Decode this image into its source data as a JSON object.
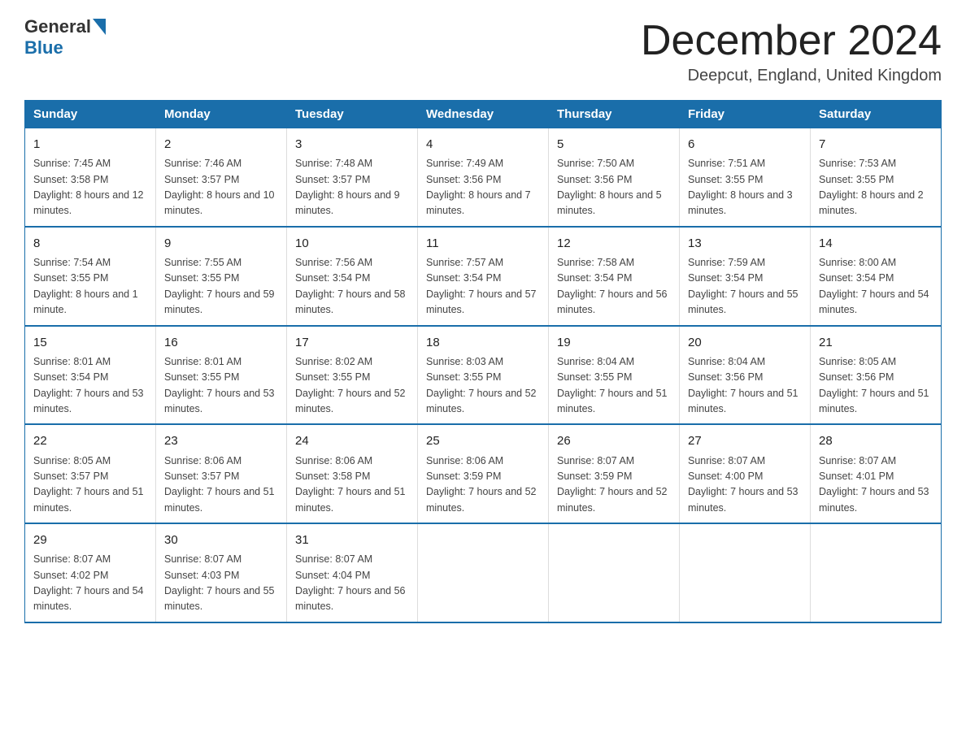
{
  "header": {
    "logo": {
      "general": "General",
      "blue": "Blue"
    },
    "title": "December 2024",
    "location": "Deepcut, England, United Kingdom"
  },
  "columns": [
    "Sunday",
    "Monday",
    "Tuesday",
    "Wednesday",
    "Thursday",
    "Friday",
    "Saturday"
  ],
  "weeks": [
    [
      {
        "day": "1",
        "sunrise": "7:45 AM",
        "sunset": "3:58 PM",
        "daylight": "8 hours and 12 minutes."
      },
      {
        "day": "2",
        "sunrise": "7:46 AM",
        "sunset": "3:57 PM",
        "daylight": "8 hours and 10 minutes."
      },
      {
        "day": "3",
        "sunrise": "7:48 AM",
        "sunset": "3:57 PM",
        "daylight": "8 hours and 9 minutes."
      },
      {
        "day": "4",
        "sunrise": "7:49 AM",
        "sunset": "3:56 PM",
        "daylight": "8 hours and 7 minutes."
      },
      {
        "day": "5",
        "sunrise": "7:50 AM",
        "sunset": "3:56 PM",
        "daylight": "8 hours and 5 minutes."
      },
      {
        "day": "6",
        "sunrise": "7:51 AM",
        "sunset": "3:55 PM",
        "daylight": "8 hours and 3 minutes."
      },
      {
        "day": "7",
        "sunrise": "7:53 AM",
        "sunset": "3:55 PM",
        "daylight": "8 hours and 2 minutes."
      }
    ],
    [
      {
        "day": "8",
        "sunrise": "7:54 AM",
        "sunset": "3:55 PM",
        "daylight": "8 hours and 1 minute."
      },
      {
        "day": "9",
        "sunrise": "7:55 AM",
        "sunset": "3:55 PM",
        "daylight": "7 hours and 59 minutes."
      },
      {
        "day": "10",
        "sunrise": "7:56 AM",
        "sunset": "3:54 PM",
        "daylight": "7 hours and 58 minutes."
      },
      {
        "day": "11",
        "sunrise": "7:57 AM",
        "sunset": "3:54 PM",
        "daylight": "7 hours and 57 minutes."
      },
      {
        "day": "12",
        "sunrise": "7:58 AM",
        "sunset": "3:54 PM",
        "daylight": "7 hours and 56 minutes."
      },
      {
        "day": "13",
        "sunrise": "7:59 AM",
        "sunset": "3:54 PM",
        "daylight": "7 hours and 55 minutes."
      },
      {
        "day": "14",
        "sunrise": "8:00 AM",
        "sunset": "3:54 PM",
        "daylight": "7 hours and 54 minutes."
      }
    ],
    [
      {
        "day": "15",
        "sunrise": "8:01 AM",
        "sunset": "3:54 PM",
        "daylight": "7 hours and 53 minutes."
      },
      {
        "day": "16",
        "sunrise": "8:01 AM",
        "sunset": "3:55 PM",
        "daylight": "7 hours and 53 minutes."
      },
      {
        "day": "17",
        "sunrise": "8:02 AM",
        "sunset": "3:55 PM",
        "daylight": "7 hours and 52 minutes."
      },
      {
        "day": "18",
        "sunrise": "8:03 AM",
        "sunset": "3:55 PM",
        "daylight": "7 hours and 52 minutes."
      },
      {
        "day": "19",
        "sunrise": "8:04 AM",
        "sunset": "3:55 PM",
        "daylight": "7 hours and 51 minutes."
      },
      {
        "day": "20",
        "sunrise": "8:04 AM",
        "sunset": "3:56 PM",
        "daylight": "7 hours and 51 minutes."
      },
      {
        "day": "21",
        "sunrise": "8:05 AM",
        "sunset": "3:56 PM",
        "daylight": "7 hours and 51 minutes."
      }
    ],
    [
      {
        "day": "22",
        "sunrise": "8:05 AM",
        "sunset": "3:57 PM",
        "daylight": "7 hours and 51 minutes."
      },
      {
        "day": "23",
        "sunrise": "8:06 AM",
        "sunset": "3:57 PM",
        "daylight": "7 hours and 51 minutes."
      },
      {
        "day": "24",
        "sunrise": "8:06 AM",
        "sunset": "3:58 PM",
        "daylight": "7 hours and 51 minutes."
      },
      {
        "day": "25",
        "sunrise": "8:06 AM",
        "sunset": "3:59 PM",
        "daylight": "7 hours and 52 minutes."
      },
      {
        "day": "26",
        "sunrise": "8:07 AM",
        "sunset": "3:59 PM",
        "daylight": "7 hours and 52 minutes."
      },
      {
        "day": "27",
        "sunrise": "8:07 AM",
        "sunset": "4:00 PM",
        "daylight": "7 hours and 53 minutes."
      },
      {
        "day": "28",
        "sunrise": "8:07 AM",
        "sunset": "4:01 PM",
        "daylight": "7 hours and 53 minutes."
      }
    ],
    [
      {
        "day": "29",
        "sunrise": "8:07 AM",
        "sunset": "4:02 PM",
        "daylight": "7 hours and 54 minutes."
      },
      {
        "day": "30",
        "sunrise": "8:07 AM",
        "sunset": "4:03 PM",
        "daylight": "7 hours and 55 minutes."
      },
      {
        "day": "31",
        "sunrise": "8:07 AM",
        "sunset": "4:04 PM",
        "daylight": "7 hours and 56 minutes."
      },
      null,
      null,
      null,
      null
    ]
  ]
}
